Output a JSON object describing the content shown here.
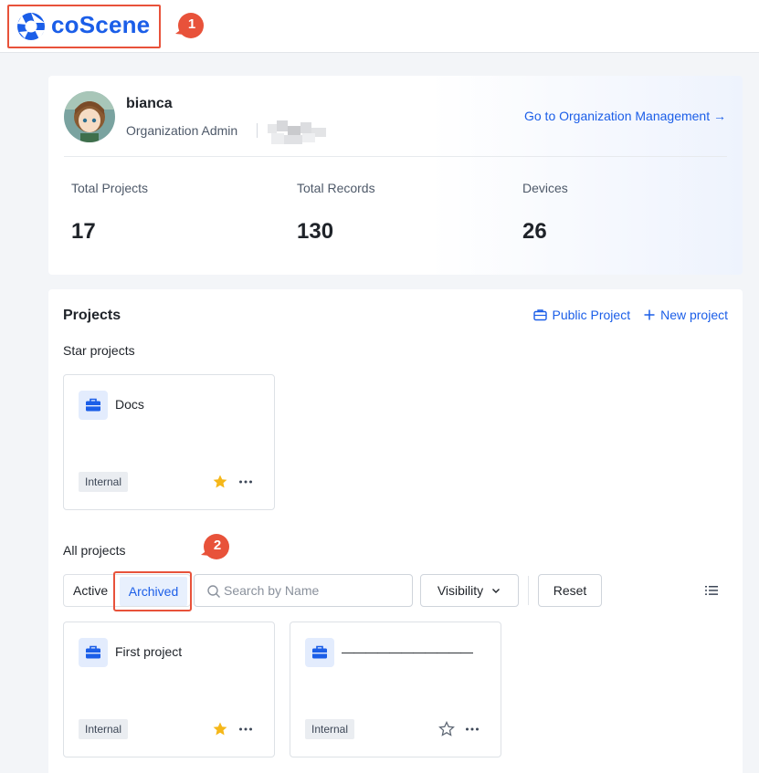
{
  "brand": {
    "logo_text": "coScene",
    "accent": "#1b5ee8"
  },
  "callouts": [
    "1",
    "2"
  ],
  "user": {
    "name": "bianca",
    "role": "Organization Admin",
    "org_link": "Go to Organization Management"
  },
  "stats": [
    {
      "label": "Total Projects",
      "value": "17"
    },
    {
      "label": "Total Records",
      "value": "130"
    },
    {
      "label": "Devices",
      "value": "26"
    }
  ],
  "projects": {
    "title": "Projects",
    "public_project_label": "Public Project",
    "new_project_label": "New project",
    "star_title": "Star projects",
    "all_title": "All projects",
    "star_items": [
      {
        "name": "Docs",
        "tag": "Internal",
        "starred": true
      }
    ],
    "filters": {
      "active_label": "Active",
      "archived_label": "Archived",
      "search_placeholder": "Search by Name",
      "visibility_label": "Visibility",
      "reset_label": "Reset"
    },
    "items": [
      {
        "name": "First project",
        "tag": "Internal",
        "starred": true
      },
      {
        "name": "———————————",
        "tag": "Internal",
        "starred": false
      }
    ]
  }
}
